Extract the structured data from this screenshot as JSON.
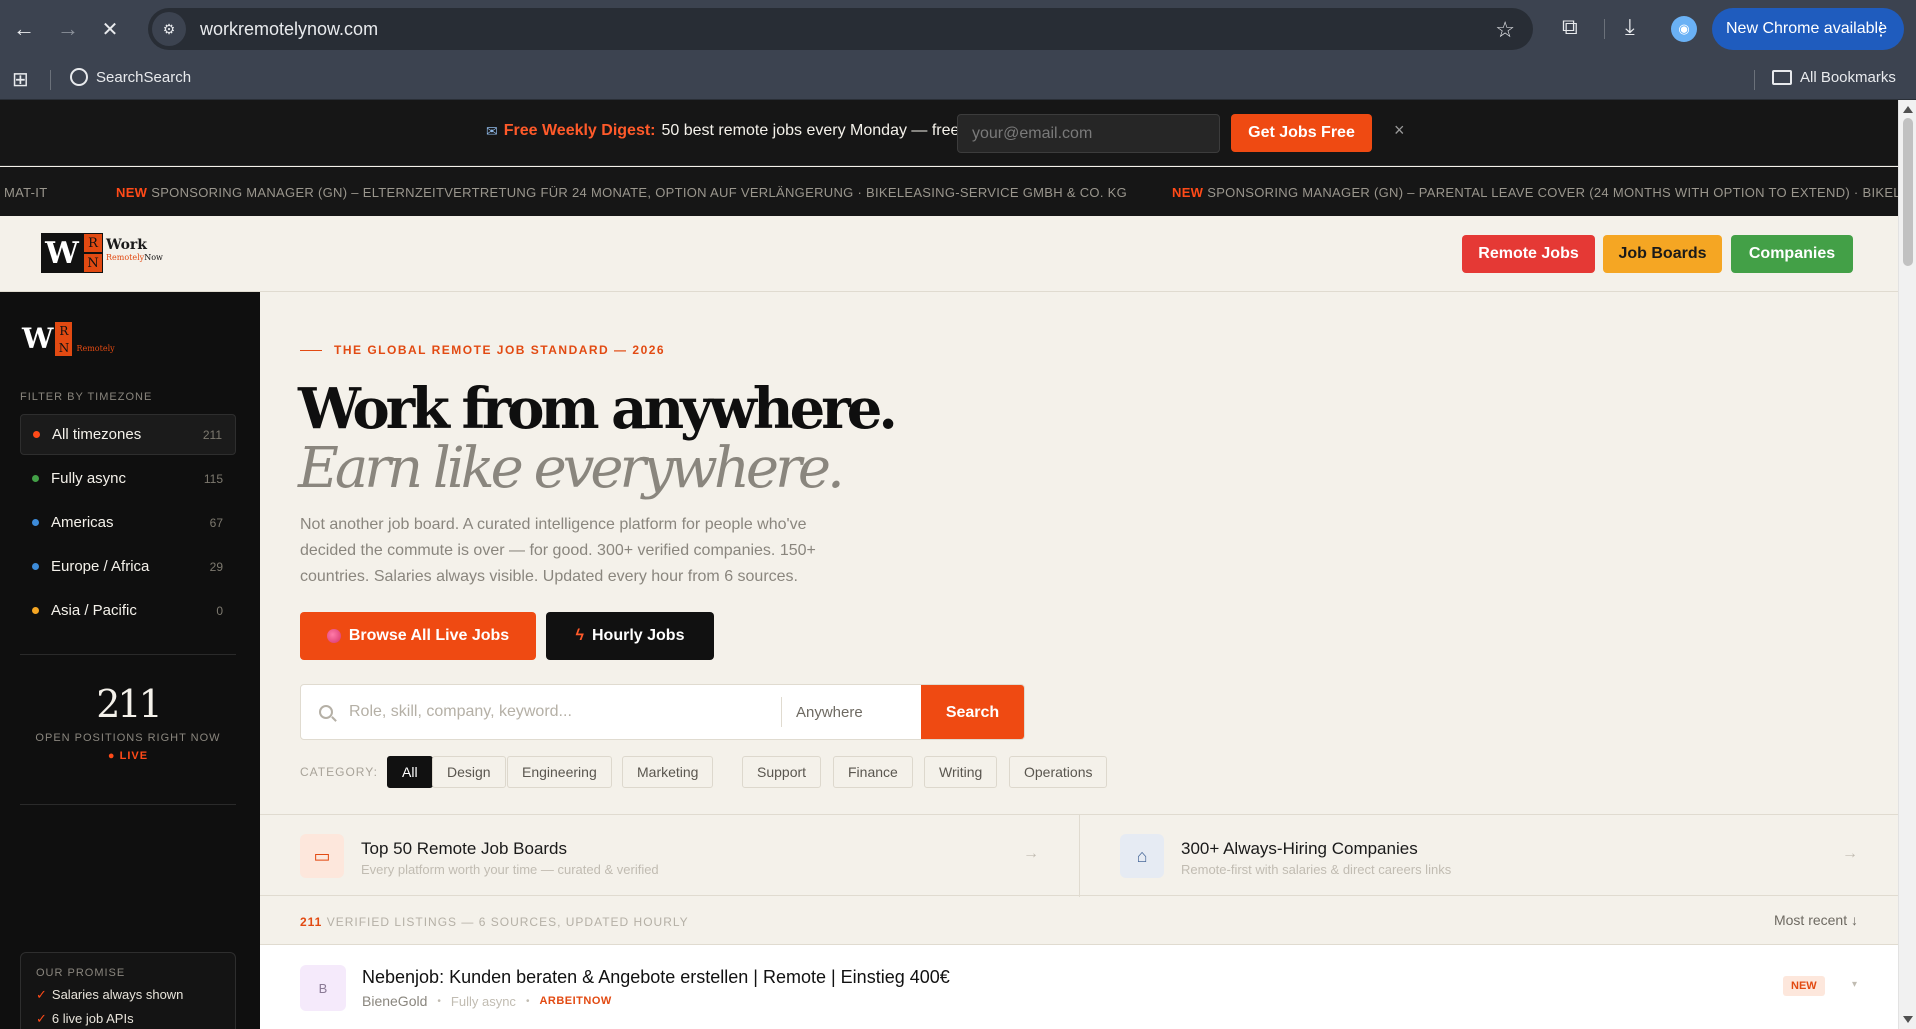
{
  "browser": {
    "url": "workremotelynow.com",
    "update_label": "New Chrome available",
    "bookmark_label": "SearchSearch",
    "all_bookmarks": "All Bookmarks"
  },
  "digest": {
    "prefix": "Free Weekly Digest:",
    "text": "50 best remote jobs every Monday — free",
    "email_placeholder": "your@email.com",
    "button": "Get Jobs Free",
    "close": "×"
  },
  "ticker": [
    {
      "new": "",
      "text": "MAT-IT"
    },
    {
      "new": "NEW",
      "text": "SPONSORING MANAGER (GN) – ELTERNZEITVERTRETUNG FÜR 24 MONATE, OPTION AUF VERLÄNGERUNG · BIKELEASING-SERVICE GMBH & CO. KG"
    },
    {
      "new": "NEW",
      "text": "SPONSORING MANAGER (GN) – PARENTAL LEAVE COVER (24 MONTHS WITH OPTION TO EXTEND) · BIKELEA"
    }
  ],
  "header": {
    "logo_top": "Work",
    "logo_remotely": "Remotely",
    "logo_now": "Now",
    "nav": [
      "Remote Jobs",
      "Job Boards",
      "Companies"
    ]
  },
  "sidebar": {
    "logo_tag": "Remotely",
    "heading": "FILTER BY TIMEZONE",
    "timezones": [
      {
        "label": "All timezones",
        "count": "211",
        "color": "#ff4a18"
      },
      {
        "label": "Fully async",
        "count": "115",
        "color": "#43a047"
      },
      {
        "label": "Americas",
        "count": "67",
        "color": "#3d8bd9"
      },
      {
        "label": "Europe / Africa",
        "count": "29",
        "color": "#3d8bd9"
      },
      {
        "label": "Asia / Pacific",
        "count": "0",
        "color": "#f5a623"
      }
    ],
    "open_count": "211",
    "open_label": "OPEN POSITIONS RIGHT NOW",
    "live": "● LIVE",
    "promise_title": "OUR PROMISE",
    "promise": [
      "Salaries always shown",
      "6 live job APIs"
    ]
  },
  "hero": {
    "eyebrow": "THE GLOBAL REMOTE JOB STANDARD — 2026",
    "title": "Work from anywhere.",
    "subtitle": "Earn like everywhere.",
    "lede": "Not another job board. A curated intelligence platform for people who've decided the commute is over — for good. 300+ verified companies. 150+ countries. Salaries always visible. Updated every hour from 6 sources.",
    "cta_primary": "Browse All Live Jobs",
    "cta_secondary": "Hourly Jobs",
    "search_placeholder": "Role, skill, company, keyword...",
    "location_placeholder": "Anywhere",
    "search_button": "Search",
    "category_label": "CATEGORY:",
    "categories": [
      "All",
      "Design",
      "Engineering",
      "Marketing",
      "Support",
      "Finance",
      "Writing",
      "Operations"
    ]
  },
  "cards": [
    {
      "title": "Top 50 Remote Job Boards",
      "sub": "Every platform worth your time — curated & verified",
      "arrow": "→"
    },
    {
      "title": "300+ Always-Hiring Companies",
      "sub": "Remote-first with salaries & direct careers links",
      "arrow": "→"
    }
  ],
  "listings": {
    "count": "211",
    "label": "VERIFIED LISTINGS — 6 SOURCES, UPDATED HOURLY",
    "sort": "Most recent ↓",
    "jobs": [
      {
        "logo": "B",
        "title": "Nebenjob: Kunden beraten & Angebote erstellen | Remote | Einstieg 400€",
        "company": "BieneGold",
        "tz": "Fully async",
        "source": "ARBEITNOW",
        "badge": "NEW"
      }
    ]
  }
}
